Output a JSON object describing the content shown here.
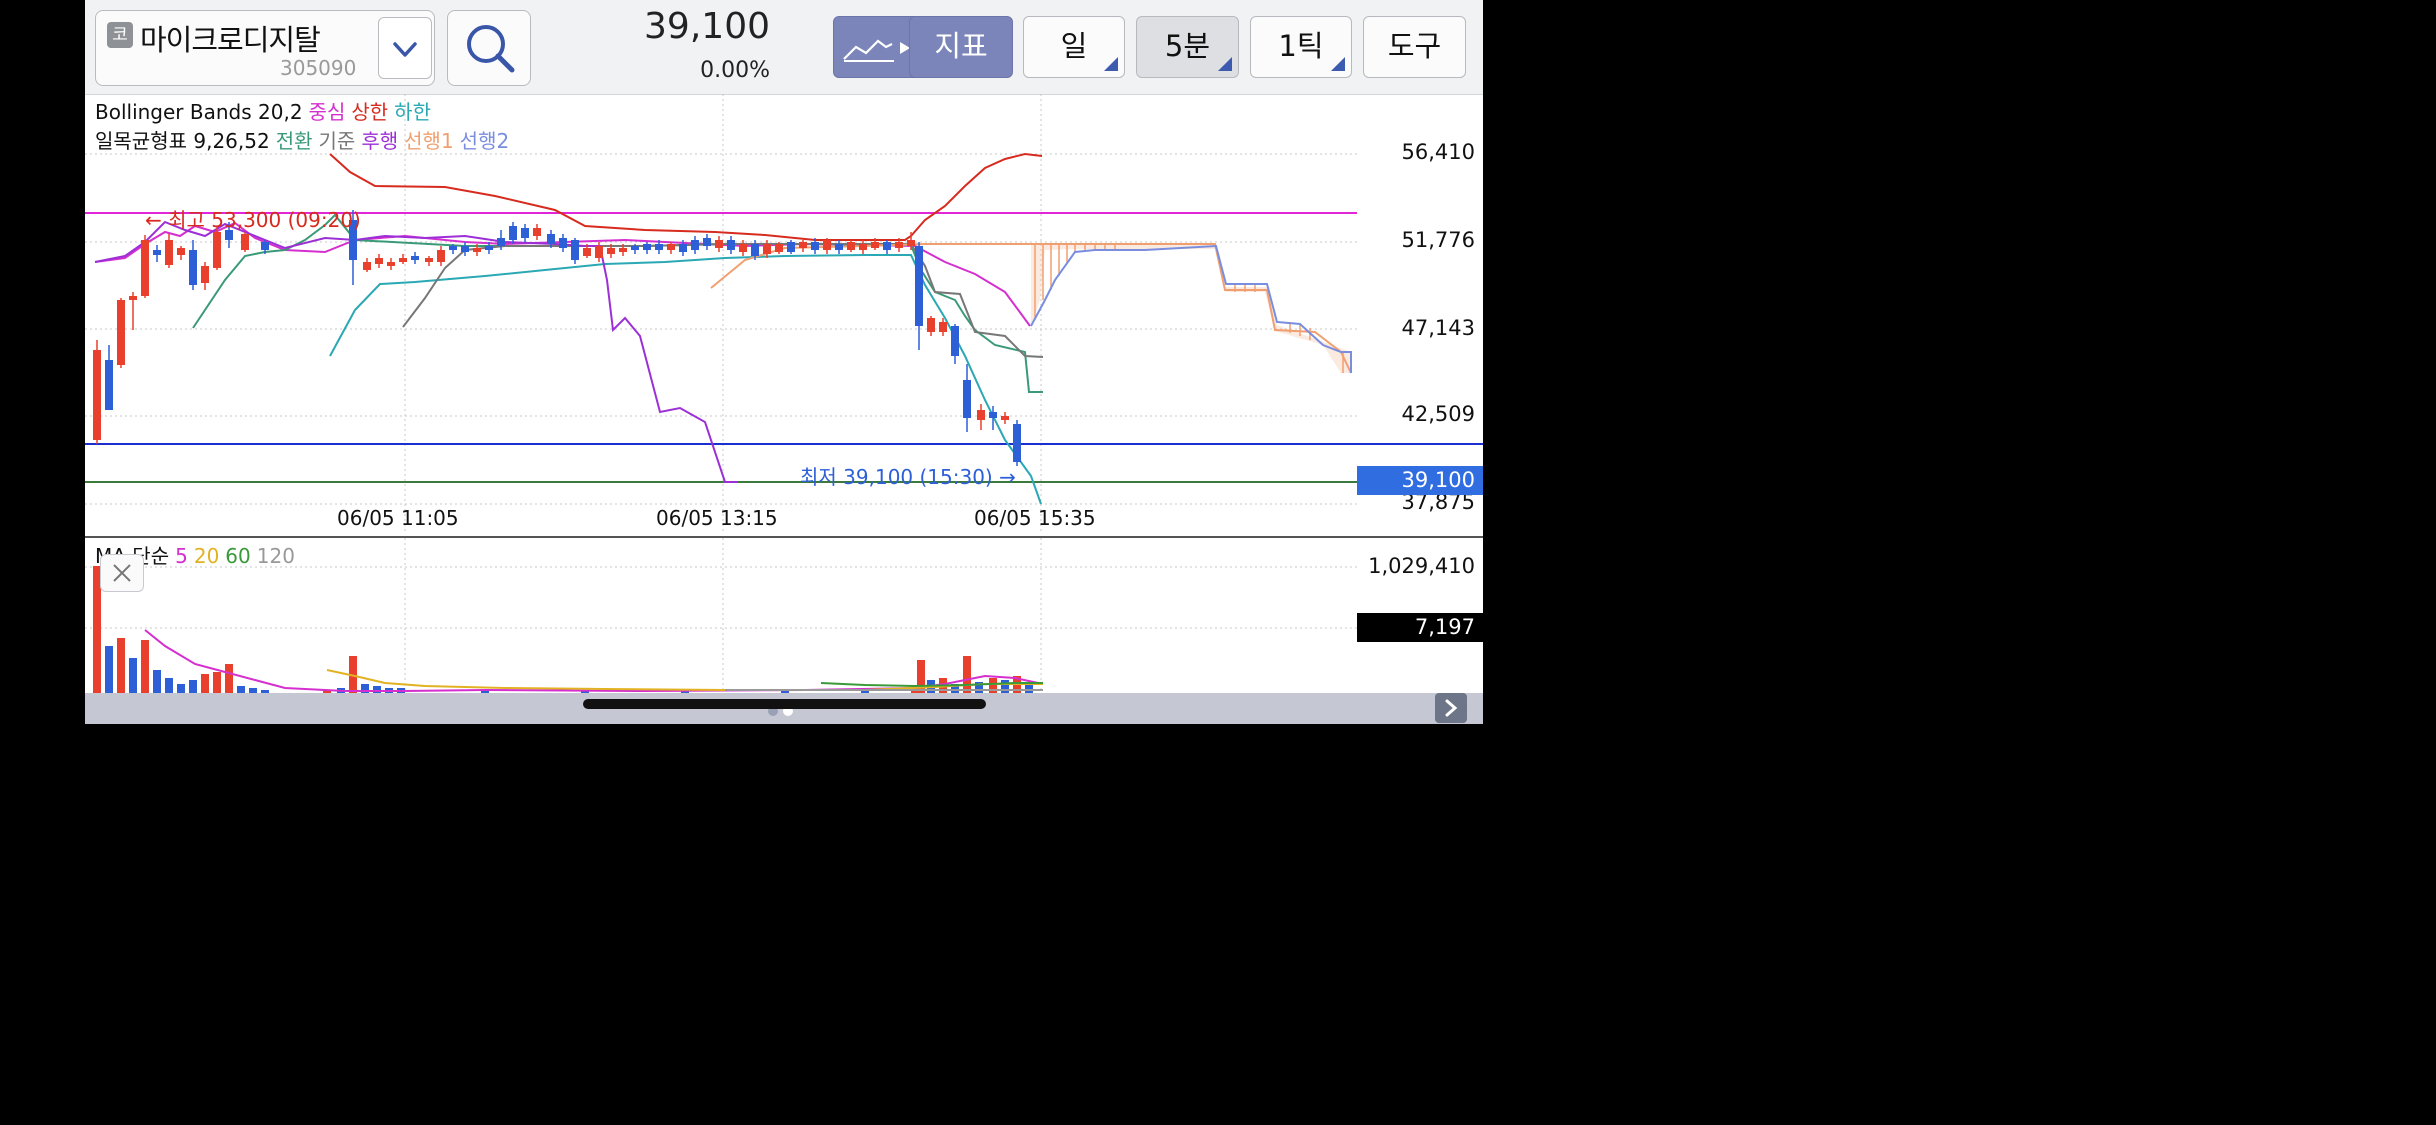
{
  "stock": {
    "badge": "코",
    "name": "마이크로디지탈",
    "code": "305090"
  },
  "quote": {
    "price": "39,100",
    "change": "0.00%"
  },
  "toolbar": {
    "indicator_label": "지표",
    "period_day": "일",
    "period_5min": "5분",
    "tick_label": "1틱",
    "tools_label": "도구"
  },
  "legend": {
    "bb": {
      "name": "Bollinger Bands 20,2",
      "center": "중심",
      "upper": "상한",
      "lower": "하한"
    },
    "ichimoku": {
      "name": "일목균형표 9,26,52",
      "conversion": "전환",
      "base": "기준",
      "lagging": "후행",
      "lead1": "선행1",
      "lead2": "선행2"
    },
    "ma": {
      "name": "MA 단순",
      "p5": "5",
      "p20": "20",
      "p60": "60",
      "p120": "120"
    }
  },
  "colors": {
    "accent": "#2f6de1",
    "up": "#e8402d",
    "down": "#2d5fd6",
    "bb_center": "#d52fcf",
    "bb_upper": "#d62b1e",
    "bb_lower": "#2aa8b4",
    "conversion": "#3a9a78",
    "base": "#777777",
    "lagging": "#9c2fd6",
    "lead1": "#f0a070",
    "lead2": "#7a8ee0",
    "ma5": "#d52fcf",
    "ma20": "#e1b323",
    "ma60": "#3a9a3a",
    "ma120": "#999999"
  },
  "price_axis": [
    "56,410",
    "51,776",
    "47,143",
    "42,509",
    "37,875"
  ],
  "time_axis": [
    "06/05 11:05",
    "06/05 13:15",
    "06/05 15:35"
  ],
  "current_price_tag": "39,100",
  "annotations": {
    "high": "← 최고 53,300 (09:20)",
    "low": "최저 39,100 (15:30) →"
  },
  "volume_axis": {
    "max": "1,029,410",
    "current": "7,197"
  },
  "icons": {
    "search": "search-icon",
    "dropdown": "chevron-down-icon",
    "chart_type": "line-chart-icon",
    "close": "close-icon",
    "scroll": "chevron-right-icon"
  }
}
